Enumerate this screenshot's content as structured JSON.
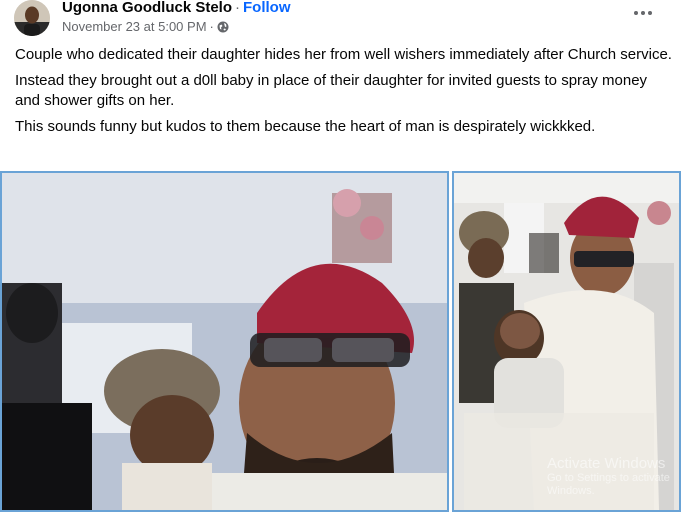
{
  "post": {
    "author": "Ugonna Goodluck Stelo",
    "separator": "·",
    "follow_label": "Follow",
    "timestamp": "November 23 at 5:00 PM",
    "meta_dot": "·",
    "privacy_icon": "globe-icon",
    "more_icon": "more-horizontal-icon",
    "paragraphs": [
      "Couple who dedicated their daughter  hides her from well wishers immediately after Church service.",
      "Instead they brought out a d0ll baby in place of their daughter for invited guests to spray money and shower gifts on her.",
      "This sounds funny but kudos to them because the heart of man is despirately wickkked."
    ]
  },
  "overlay": {
    "watermark_title": "Activate Windows",
    "watermark_sub": "Go to Settings to activate Windows."
  },
  "colors": {
    "link": "#0866ff",
    "secondary_text": "#65676b",
    "photo_border": "#6aa3d6"
  }
}
